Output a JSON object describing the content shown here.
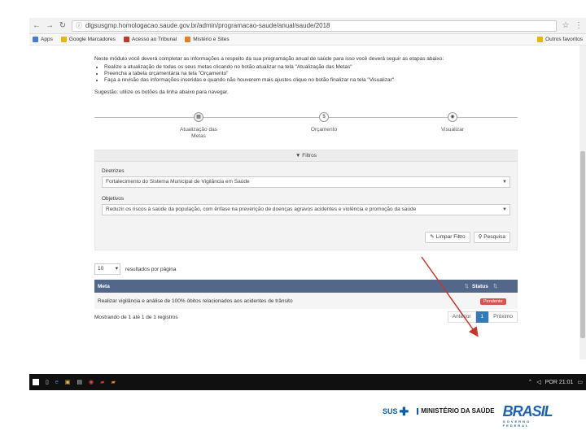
{
  "browser": {
    "url": "dlgsusgmp.homologacao.saude.gov.br/admin/programacao-saude/anual/saude/2018",
    "bookmarks": [
      "Apps",
      "Google Marcadores",
      "Acesso ao Tribunal",
      "Mistério e Sites"
    ],
    "bookmarks_right": "Outros favoritos"
  },
  "page": {
    "intro": "Neste módulo você deverá completar as informações a respeito da sua programação anual de saúde para isso você deverá seguir as etapas abaixo:",
    "bullets": [
      "Realize a atualização de todas os seus metas clicando no botão atualizar na tela \"Atualização das Metas\"",
      "Preencha a tabela orçamentária na tela \"Orçamento\"",
      "Faça a revisão das informações inseridas e quando não houverem mais ajustes clique no botão finalizar na tela \"Visualizar\""
    ],
    "hint": "Sugestão: utilize os botões da linha abaixo para navegar.",
    "steps": [
      {
        "label": "Atualização das Metas",
        "icon": "calendar-icon"
      },
      {
        "label": "Orçamento",
        "icon": "money-icon"
      },
      {
        "label": "Visualizar",
        "icon": "eye-icon"
      }
    ]
  },
  "filters": {
    "title": "▼ Filtros",
    "diretrizes_label": "Diretrizes",
    "diretrizes_value": "Fortalecimento do Sistema Municipal de Vigilância em Saúde",
    "objetivos_label": "Objetivos",
    "objetivos_value": "Reduzir os riscos à saúde da população, com ênfase na prevenção de doenças agravos acidentes e violência e promoção da saúde",
    "clear_button": "Limpar Filtro",
    "search_button": "Pesquisa"
  },
  "table": {
    "per_page_value": "10",
    "per_page_label": "resultados por página",
    "headers": [
      "Meta",
      "Status"
    ],
    "rows": [
      {
        "meta": "Realizar vigilância e análise de 100% óbitos relacionados aos acidentes de trânsito",
        "status": "Pendente"
      }
    ],
    "showing": "Mostrando de 1 até 1 de 1 registros",
    "prev": "Anterior",
    "current_page": "1",
    "next": "Próximo"
  },
  "taskbar": {
    "tray": "POR 21:01"
  },
  "footer": {
    "sus": "SUS",
    "ministerio": "MINISTÉRIO DA SAÚDE",
    "brasil": "BRASIL",
    "governo": "GOVERNO FEDERAL"
  },
  "colors": {
    "table_header": "#52678a",
    "status_badge": "#d9534f",
    "annotation_arrow": "#c0392b",
    "brand_blue": "#1f63ad"
  }
}
